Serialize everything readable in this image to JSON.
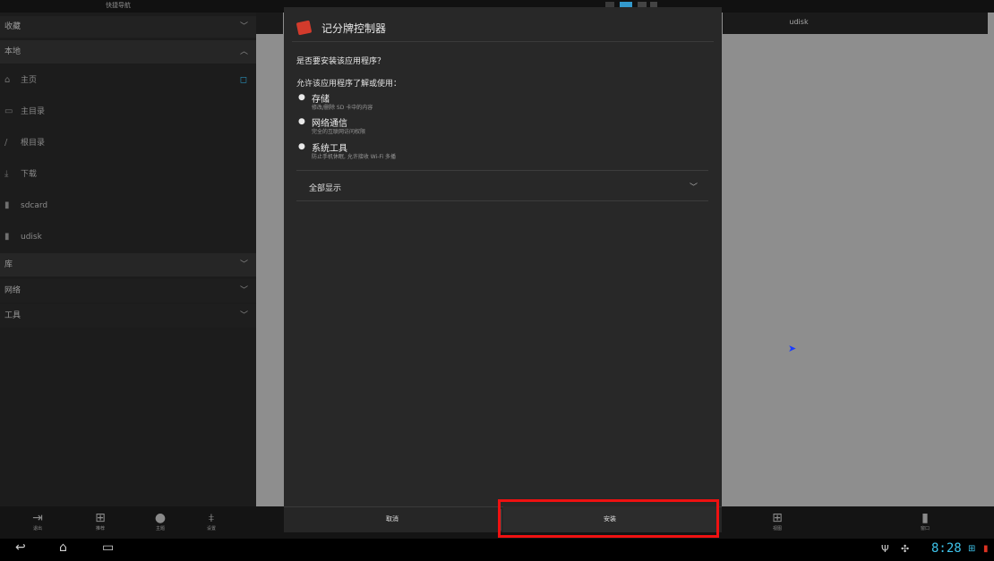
{
  "top_strip": {
    "quick_nav": "快捷导航"
  },
  "sidebar": {
    "favorites": "收藏",
    "local": "本地",
    "items": [
      {
        "label": "主页",
        "icon": "home-icon"
      },
      {
        "label": "主目录",
        "icon": "folder-icon"
      },
      {
        "label": "根目录",
        "icon": "slash-icon"
      },
      {
        "label": "下载",
        "icon": "download-icon"
      },
      {
        "label": "sdcard",
        "icon": "sdcard-icon"
      },
      {
        "label": "udisk",
        "icon": "sdcard-icon"
      }
    ],
    "library": "库",
    "network": "网络",
    "tools": "工具"
  },
  "right_tab": {
    "title": "udisk"
  },
  "toolbar": {
    "exit": "退出",
    "recommend": "推荐",
    "theme": "主题",
    "settings": "设置",
    "view": "视图",
    "window": "窗口"
  },
  "dialog": {
    "app_name": "记分牌控制器",
    "question": "是否要安装该应用程序？",
    "allow_text": "允许该应用程序了解或使用：",
    "permissions": [
      {
        "title": "存储",
        "detail": "修改/删除 SD 卡中的内容"
      },
      {
        "title": "网络通信",
        "detail": "完全的互联网访问权限"
      },
      {
        "title": "系统工具",
        "detail": "防止手机休眠, 允许接收 Wi-Fi 多播"
      }
    ],
    "show_all": "全部显示",
    "cancel": "取消",
    "install": "安装"
  },
  "status": {
    "clock": "8:28"
  },
  "colors": {
    "accent": "#3ec3ea",
    "highlight": "#ee1111",
    "dialog_bg": "#282828"
  }
}
